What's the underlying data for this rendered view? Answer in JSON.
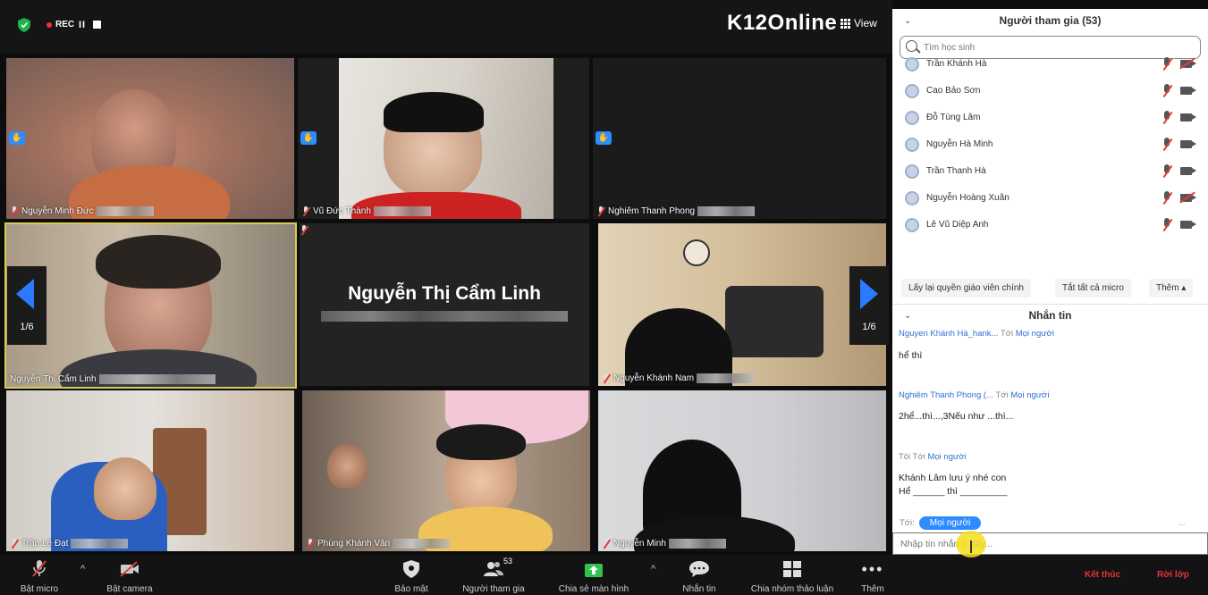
{
  "top_bar": {
    "rec_label": "REC",
    "pause_label": "II",
    "logo": "K12Online",
    "view_label": "View"
  },
  "tiles": [
    {
      "name": "Nguyễn Minh Đức",
      "hand": true,
      "mic_off": true
    },
    {
      "name": "Vũ Đức Thành",
      "hand": true,
      "mic_off": true
    },
    {
      "name": "Nghiêm Thanh Phong",
      "hand": true,
      "mic_off": true
    },
    {
      "name": "Nguyễn Thị Cẩm Linh",
      "hand": false,
      "mic_off": false
    },
    {
      "name": "",
      "hand": false,
      "mic_off": true
    },
    {
      "name": "Nguyễn Khánh Nam",
      "hand": false,
      "mic_off": true
    },
    {
      "name": "Trần Lê Đạt",
      "hand": false,
      "mic_off": true
    },
    {
      "name": "Phùng Khánh Vân",
      "hand": false,
      "mic_off": true
    },
    {
      "name": "Nguyễn Minh",
      "hand": false,
      "mic_off": true
    }
  ],
  "center_tile_name": "Nguyễn Thị Cẩm Linh",
  "pagination": {
    "left": "1/6",
    "right": "1/6"
  },
  "toolbar": {
    "mic": "Bật micro",
    "camera": "Bật camera",
    "security": "Bảo mật",
    "participants": "Người tham gia",
    "participants_count": "53",
    "share": "Chia sẻ màn hình",
    "chat": "Nhắn tin",
    "breakout": "Chia nhóm thảo luận",
    "more": "Thêm",
    "end": "Kết thúc",
    "leave": "Rời lớp"
  },
  "participants_panel": {
    "title": "Người tham gia (53)",
    "search_placeholder": "Tìm học sinh",
    "list": [
      {
        "name": "Trần Khánh Hà",
        "cam_off": true
      },
      {
        "name": "Cao Bảo Sơn",
        "cam_off": false
      },
      {
        "name": "Đỗ Tùng Lâm",
        "cam_off": false
      },
      {
        "name": "Nguyễn Hà Minh",
        "cam_off": false
      },
      {
        "name": "Trần Thanh Hà",
        "cam_off": false
      },
      {
        "name": "Nguyễn Hoàng Xuân",
        "cam_off": true
      },
      {
        "name": "Lê Vũ Diệp Anh",
        "cam_off": false
      }
    ],
    "btn_reclaim": "Lấy lại quyền giáo viên chính",
    "btn_mute_all": "Tắt tất cả micro",
    "btn_more": "Thêm ▴"
  },
  "chat_panel": {
    "title": "Nhắn tin",
    "messages": [
      {
        "from": "Nguyen Khánh Hà_hank...",
        "to_label": "Tới",
        "to": "Mọi người",
        "text": "hể thì"
      },
      {
        "from": "Nghiêm Thanh Phong (...",
        "to_label": "Tới",
        "to": "Mọi người",
        "text": "2hể...thì...,3Nếu như ...thì..."
      },
      {
        "from": "Tôi",
        "to_label": "Tới",
        "to": "Mọi người",
        "text": "Khánh Lâm lưu ý nhé con",
        "text2": "Hể ______ thì _________"
      }
    ],
    "recipient_label": "Tới:",
    "recipient": "Mọi người",
    "dots": "...",
    "input_placeholder": "Nhập tin nhắn ở đây..."
  }
}
